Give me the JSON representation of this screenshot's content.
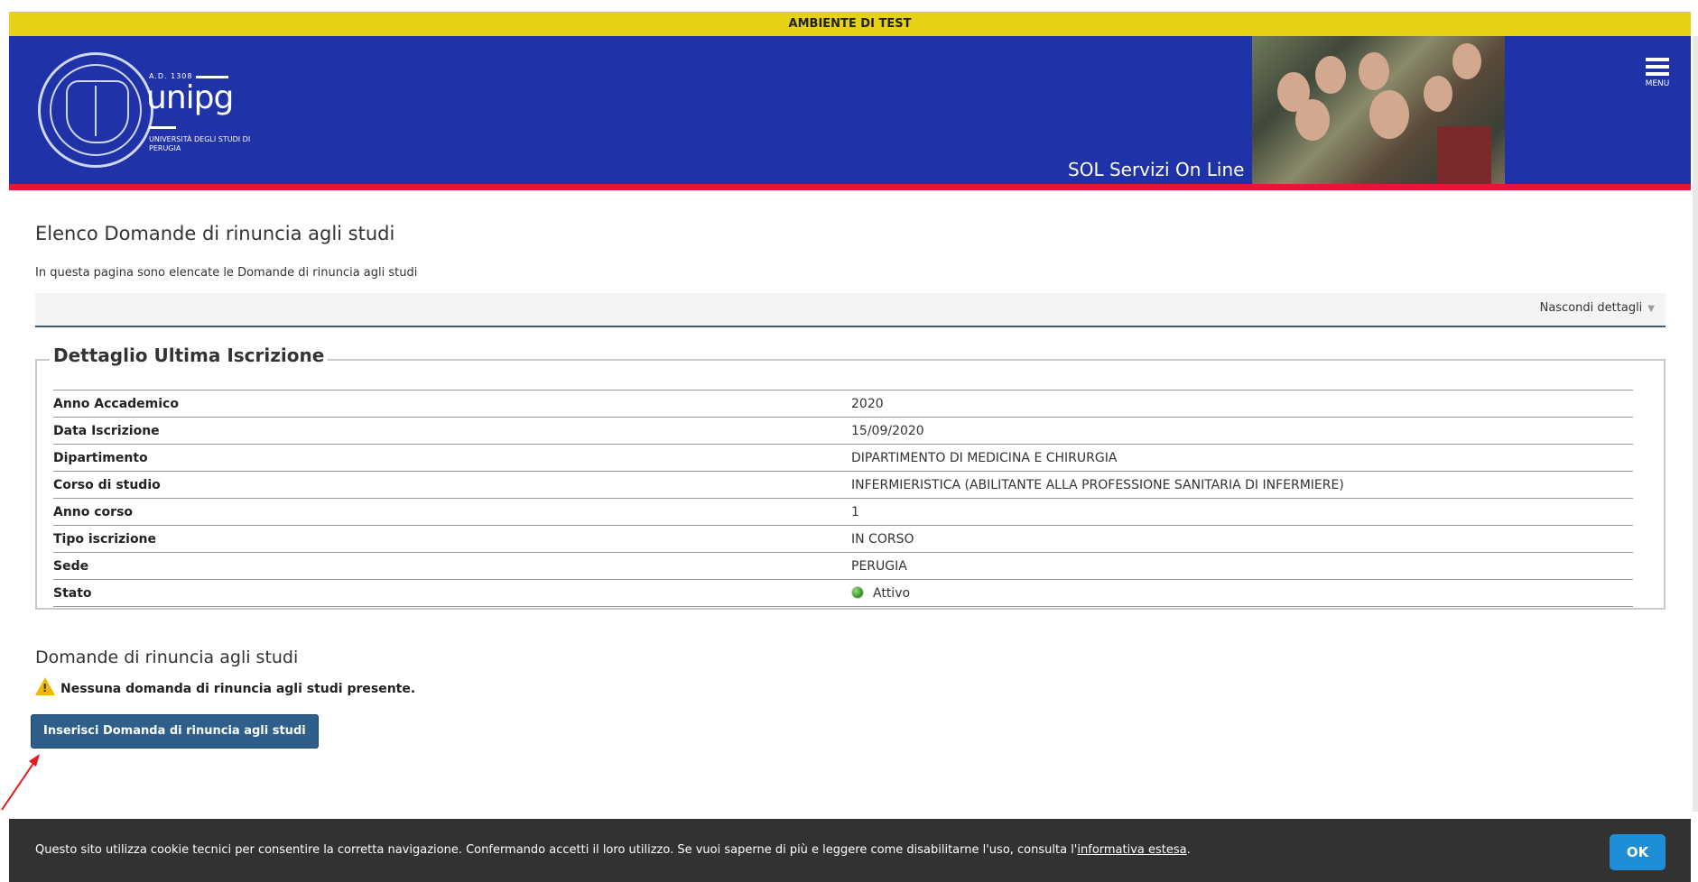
{
  "env_banner": "AMBIENTE DI TEST",
  "header": {
    "brand_ad": "A.D. 1308",
    "brand_name": "unipg",
    "brand_sub": "UNIVERSITÀ DEGLI STUDI DI PERUGIA",
    "service_title": "SOL Servizi On Line",
    "menu_label": "MENU",
    "colors": {
      "banner": "#e6d117",
      "header": "#1f32a8",
      "accent": "#e3173a"
    }
  },
  "page": {
    "title": "Elenco Domande di rinuncia agli studi",
    "description": "In questa pagina sono elencate le Domande di rinuncia agli studi",
    "details_toggle": "Nascondi dettagli"
  },
  "last_enrollment": {
    "legend": "Dettaglio Ultima Iscrizione",
    "rows": [
      {
        "label": "Anno Accademico",
        "value": "2020"
      },
      {
        "label": "Data Iscrizione",
        "value": "15/09/2020"
      },
      {
        "label": "Dipartimento",
        "value": "DIPARTIMENTO DI MEDICINA E CHIRURGIA"
      },
      {
        "label": "Corso di studio",
        "value": "INFERMIERISTICA (ABILITANTE ALLA PROFESSIONE SANITARIA DI INFERMIERE)"
      },
      {
        "label": "Anno corso",
        "value": "1"
      },
      {
        "label": "Tipo iscrizione",
        "value": "IN CORSO"
      },
      {
        "label": "Sede",
        "value": "PERUGIA"
      },
      {
        "label": "Stato",
        "value": "Attivo",
        "status_color": "#3da12d"
      }
    ]
  },
  "requests": {
    "title": "Domande di rinuncia agli studi",
    "empty_message": "Nessuna domanda di rinuncia agli studi presente.",
    "insert_button": "Inserisci Domanda di rinuncia agli studi"
  },
  "cookie": {
    "text": "Questo sito utilizza cookie tecnici per consentire la corretta navigazione. Confermando accetti il loro utilizzo. Se vuoi saperne di più e leggere come disabilitarne l'uso, consulta l'",
    "link": "informativa estesa",
    "after": ".",
    "ok": "OK"
  }
}
